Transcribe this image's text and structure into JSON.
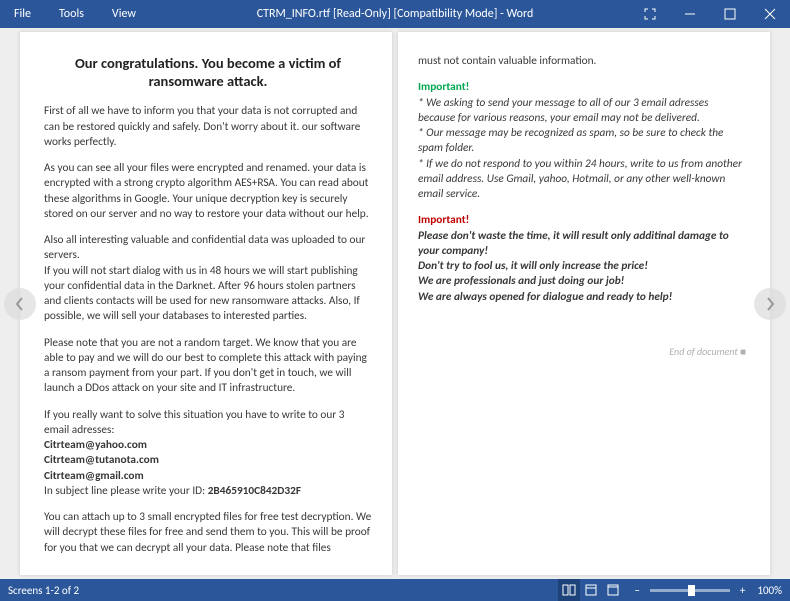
{
  "titlebar": {
    "menus": [
      "File",
      "Tools",
      "View"
    ],
    "title": "CTRM_INFO.rtf [Read-Only] [Compatibility Mode] - Word"
  },
  "page1": {
    "heading": "Our congratulations. You become a victim of ransomware attack.",
    "p1": "First of all we have to inform you that your data is not corrupted and can be restored quickly and safely. Don't worry about it. our software works perfectly.",
    "p2": "As you can see all your files were encrypted and renamed. your data is encrypted with a strong crypto algorithm AES+RSA. You can read about these algorithms in Google. Your unique decryption key is securely stored on our server and no way to restore your data without our help.",
    "p3": "Also all interesting valuable and confidential data was uploaded to our servers.",
    "p4": "If you will not start dialog with us in 48 hours we will start publishing your confidential data in the Darknet. After 96 hours stolen partners and clients contacts will be used for new ransomware attacks. Also, If possible, we will sell your databases to interested parties.",
    "p5": "Please note that you are not a random target. We know that you are able to pay and we will do our best to complete this attack with paying a ransom payment from your part. If you don't get in touch, we will launch a DDos attack on your site and IT infrastructure.",
    "p6": "If you really want to solve this situation you have to write to our 3 email adresses:",
    "email1": "Citrteam@yahoo.com",
    "email2": "Citrteam@tutanota.com",
    "email3": "Citrteam@gmail.com",
    "id_prefix": "In subject line please write your ID: ",
    "id": "2B465910C842D32F",
    "p7": "You can attach up to 3 small encrypted files for free test decryption. We will decrypt these files for free and send them to you. This will be proof for you that we can decrypt all your data. Please note that files"
  },
  "page2": {
    "p1": "must not contain valuable information.",
    "imp1_label": "Important!",
    "imp1_a": "* We asking to send your message to all of our 3 email adresses because for various reasons, your email may not be delivered.",
    "imp1_b": "* Our message may be recognized as spam, so be sure to check the spam folder.",
    "imp1_c": "* If we do not respond to you within 24 hours, write to us from another email address. Use Gmail, yahoo, Hotmail, or any other well-known email service.",
    "imp2_label": "Important!",
    "imp2_a": "Please don't waste the time, it will result only additinal damage to your company!",
    "imp2_b": "Don't try to fool us, it will only increase the price!",
    "imp2_c": "We are professionals and just doing our job!",
    "imp2_d": "We are always opened for dialogue and ready to help!",
    "endmark": "End of document  ■"
  },
  "statusbar": {
    "left": "Screens 1-2 of 2",
    "zoom": "100%"
  }
}
